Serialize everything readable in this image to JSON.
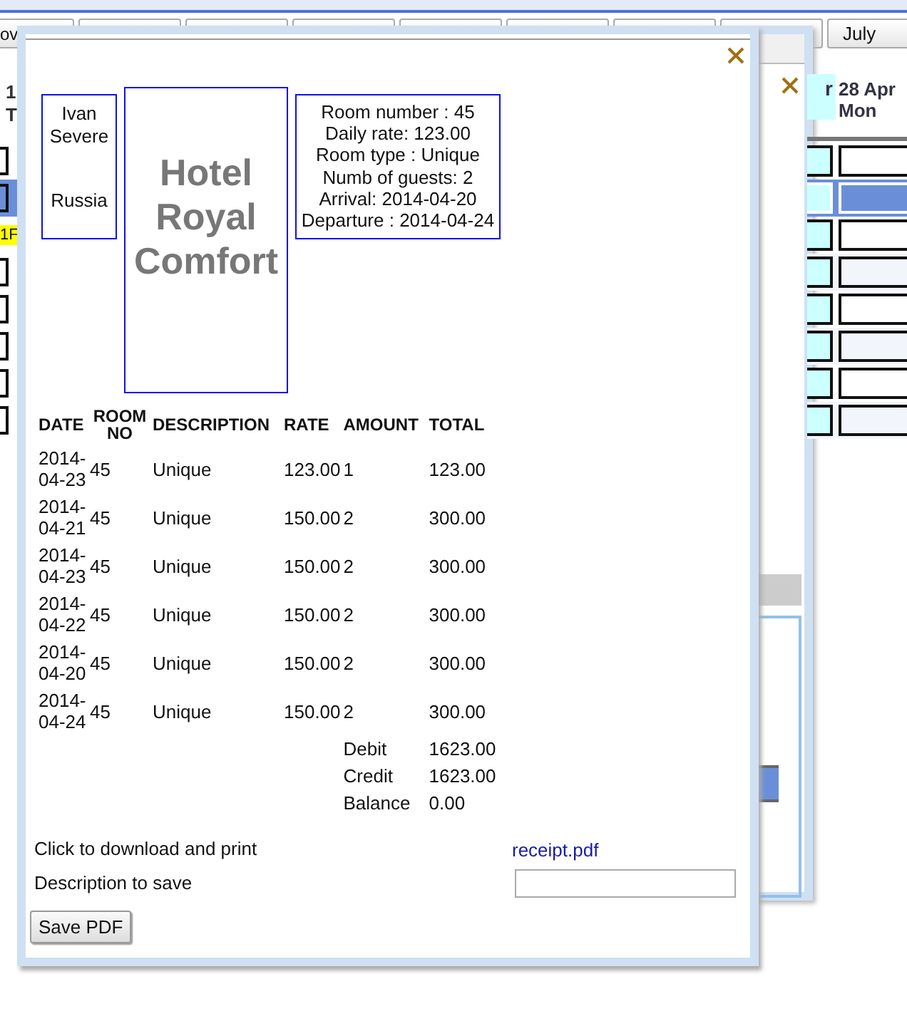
{
  "background": {
    "nav": {
      "left_button": "ov",
      "right_button": "July"
    },
    "calendar": {
      "left_header_lines": [
        "1",
        "T"
      ],
      "left_tag": "1F",
      "cut_column_header": "r",
      "column_header_lines": [
        "28 Apr",
        "Mon"
      ],
      "rows": [
        {
          "selected": false
        },
        {
          "selected": true
        },
        {
          "selected": false
        },
        {
          "selected": false
        },
        {
          "selected": false
        },
        {
          "selected": false
        },
        {
          "selected": false
        },
        {
          "selected": false
        }
      ]
    }
  },
  "receipt": {
    "guest": {
      "name_lines": [
        "Ivan",
        "Severe"
      ],
      "country": "Russia"
    },
    "hotel_name": "Hotel Royal Comfort",
    "room_info": [
      "Room number : 45",
      "Daily rate: 123.00",
      "Room type : Unique",
      "Numb of guests: 2",
      "Arrival: 2014-04-20",
      "Departure : 2014-04-24"
    ],
    "table": {
      "columns": [
        "DATE",
        "ROOM NO",
        "DESCRIPTION",
        "RATE",
        "AMOUNT",
        "TOTAL"
      ],
      "rows": [
        [
          "2014-04-23",
          "45",
          "Unique",
          "123.00",
          "1",
          "123.00"
        ],
        [
          "2014-04-21",
          "45",
          "Unique",
          "150.00",
          "2",
          "300.00"
        ],
        [
          "2014-04-23",
          "45",
          "Unique",
          "150.00",
          "2",
          "300.00"
        ],
        [
          "2014-04-22",
          "45",
          "Unique",
          "150.00",
          "2",
          "300.00"
        ],
        [
          "2014-04-20",
          "45",
          "Unique",
          "150.00",
          "2",
          "300.00"
        ],
        [
          "2014-04-24",
          "45",
          "Unique",
          "150.00",
          "2",
          "300.00"
        ]
      ],
      "totals": [
        {
          "label": "Debit",
          "value": "1623.00"
        },
        {
          "label": "Credit",
          "value": "1623.00"
        },
        {
          "label": "Balance",
          "value": "0.00"
        }
      ]
    },
    "download_label": "Click to download and print",
    "download_link": "receipt.pdf",
    "description_label": "Description to save",
    "save_button": "Save PDF"
  }
}
